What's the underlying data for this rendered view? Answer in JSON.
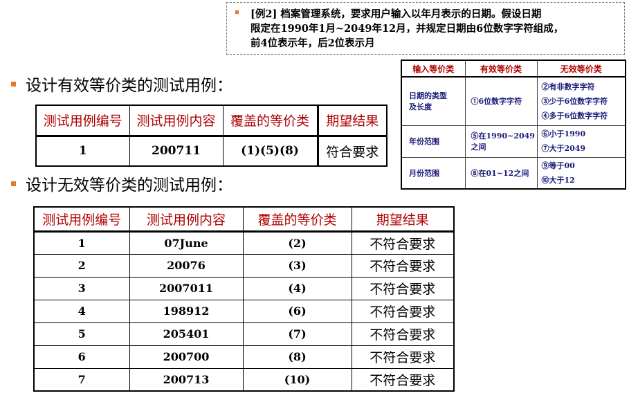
{
  "note": {
    "lines": [
      "[例2] 档案管理系统，要求用户输入以年月表示的日期。假设日期",
      "限定在1990年1月~2049年12月，并规定日期由6位数字字符组成，",
      "前4位表示年，后2位表示月"
    ]
  },
  "headings": {
    "valid": "设计有效等价类的测试用例：",
    "invalid": "设计无效等价类的测试用例："
  },
  "valid_table": {
    "headers": [
      "测试用例编号",
      "测试用例内容",
      "覆盖的等价类",
      "期望结果"
    ],
    "rows": [
      [
        "1",
        "200711",
        "(1)(5)(8)",
        "符合要求"
      ]
    ]
  },
  "invalid_table": {
    "headers": [
      "测试用例编号",
      "测试用例内容",
      "覆盖的等价类",
      "期望结果"
    ],
    "rows": [
      [
        "1",
        "07June",
        "(2)",
        "不符合要求"
      ],
      [
        "2",
        "20076",
        "(3)",
        "不符合要求"
      ],
      [
        "3",
        "2007011",
        "(4)",
        "不符合要求"
      ],
      [
        "4",
        "198912",
        "(6)",
        "不符合要求"
      ],
      [
        "5",
        "205401",
        "(7)",
        "不符合要求"
      ],
      [
        "6",
        "200700",
        "(8)",
        "不符合要求"
      ],
      [
        "7",
        "200713",
        "(10)",
        "不符合要求"
      ]
    ]
  },
  "eq_table": {
    "headers": [
      "输入等价类",
      "有效等价类",
      "无效等价类"
    ],
    "rows": [
      {
        "input": [
          "日期的类型",
          "及长度"
        ],
        "valid": [
          "①6位数字字符"
        ],
        "invalid": [
          "②有非数字字符",
          "③少于6位数字字符",
          "④多于6位数字字符"
        ]
      },
      {
        "input": [
          "年份范围"
        ],
        "valid": [
          "⑤在1990~2049",
          "之间"
        ],
        "invalid": [
          "⑥小于1990",
          "⑦大于2049"
        ]
      },
      {
        "input": [
          "月份范围"
        ],
        "valid": [
          "⑧在01~12之间"
        ],
        "invalid": [
          "⑨等于00",
          "⑩大于12"
        ]
      }
    ]
  },
  "colors": {
    "header_red": "#b00000",
    "bullet_orange": "#e0782a",
    "eq_text_blue": "#1a1a7a"
  }
}
